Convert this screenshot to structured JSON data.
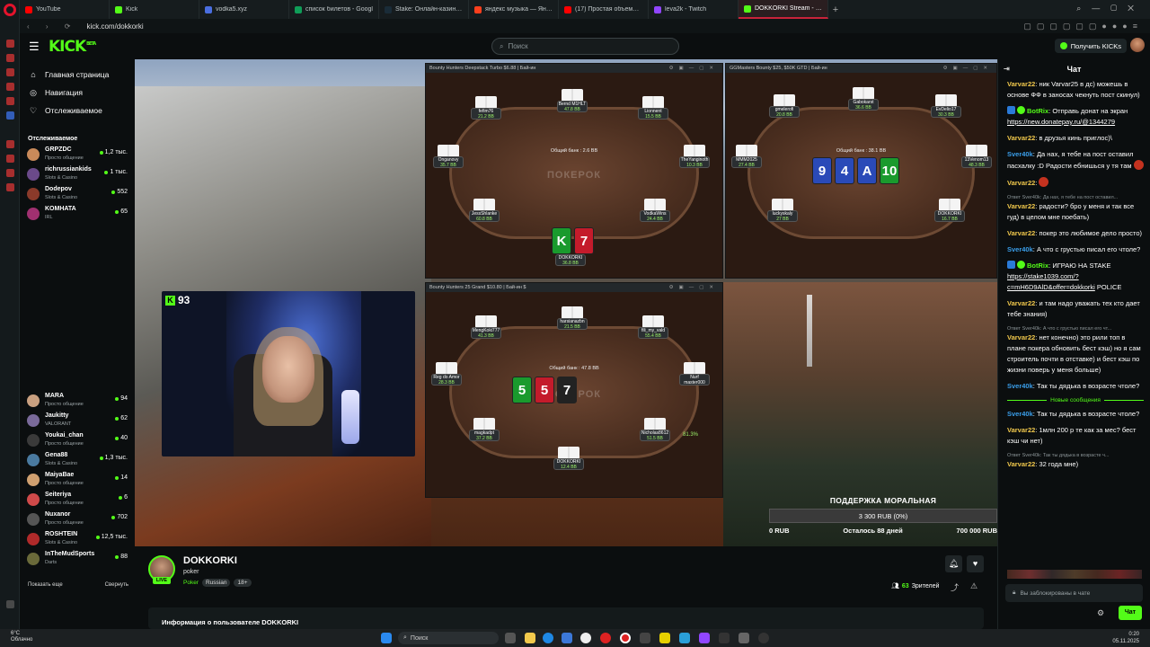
{
  "browser": {
    "tabs": [
      {
        "label": "YouTube",
        "color": "#ff0000"
      },
      {
        "label": "Kick",
        "color": "#53fc18"
      },
      {
        "label": "vodka5.xyz",
        "color": "#4a6ee0"
      },
      {
        "label": "список билетов - Googl",
        "color": "#0f9d58"
      },
      {
        "label": "Stake: Онлайн-казино и",
        "color": "#1a2c38"
      },
      {
        "label": "яндекс музыка — Яндекс",
        "color": "#fc3f1d"
      },
      {
        "label": "(17) Простая объемная",
        "color": "#ff0000"
      },
      {
        "label": "leva2k - Twitch",
        "color": "#9146ff"
      },
      {
        "label": "DOKKORKI Stream - Watc",
        "color": "#53fc18"
      }
    ],
    "url": "kick.com/dokkorki"
  },
  "header": {
    "logo": "KICK",
    "logo_beta": "BETA",
    "search_placeholder": "Поиск",
    "get_kicks": "Получить KICKs"
  },
  "sidebar": {
    "nav": [
      {
        "label": "Главная страница",
        "icon": "home-icon"
      },
      {
        "label": "Навигация",
        "icon": "compass-icon"
      },
      {
        "label": "Отслеживаемое",
        "icon": "heart-icon"
      }
    ],
    "following_title": "Отслеживаемое",
    "following": [
      {
        "name": "GRPZDC",
        "category": "Просто общение",
        "viewers": "1,2 тыс.",
        "color": "#c98a5a"
      },
      {
        "name": "richrussiankids",
        "category": "Slots & Casino",
        "viewers": "1 тыс.",
        "color": "#6b4a8a"
      },
      {
        "name": "Dodepov",
        "category": "Slots & Casino",
        "viewers": "552",
        "color": "#8a3a2a"
      },
      {
        "name": "KOMHATA",
        "category": "IRL",
        "viewers": "65",
        "color": "#a03070"
      },
      {
        "name": "MARA",
        "category": "Просто общение",
        "viewers": "94",
        "color": "#c9a080"
      },
      {
        "name": "Jaukitty",
        "category": "VALORANT",
        "viewers": "62",
        "color": "#7a6a9a"
      },
      {
        "name": "Youkai_chan",
        "category": "Просто общение",
        "viewers": "40",
        "color": "#3a3a3a"
      },
      {
        "name": "Gena88",
        "category": "Slots & Casino",
        "viewers": "1,3 тыс.",
        "color": "#4a7aa0"
      },
      {
        "name": "MaiyaBae",
        "category": "Просто общение",
        "viewers": "14",
        "color": "#d0a070"
      },
      {
        "name": "Seiteriya",
        "category": "Просто общение",
        "viewers": "6",
        "color": "#d04a4a"
      },
      {
        "name": "Nuxanor",
        "category": "Просто общение",
        "viewers": "702",
        "color": "#555555"
      },
      {
        "name": "ROSHTEIN",
        "category": "Slots & Casino",
        "viewers": "12,5 тыс.",
        "color": "#b02a2a"
      },
      {
        "name": "InTheMudSports",
        "category": "Darts",
        "viewers": "88",
        "color": "#6a6a3a"
      }
    ],
    "show_more": "Показать еще",
    "collapse": "Свернуть"
  },
  "stream": {
    "webcam_count": "93",
    "tables": [
      {
        "title": "Bounty Hunters Deepstack Turbo $6.88 | Бай-ин",
        "brand": "ПОКЕРОК",
        "pot": "Общий банк : 2.6 BB",
        "seats": [
          {
            "name": "Bernd M1HLT",
            "stack": "47.8 BB"
          },
          {
            "name": "fefim76",
            "stack": "21.2 BB"
          },
          {
            "name": "Lionnent",
            "stack": "15.5 BB"
          },
          {
            "name": "Onganovy",
            "stack": "35.7 BB"
          },
          {
            "name": "TheYanginoth",
            "stack": "10.3 BB"
          },
          {
            "name": "JessShlanke",
            "stack": "60.8 BB"
          },
          {
            "name": "VodkaWins",
            "stack": "24.4 BB"
          },
          {
            "name": "DOKKORKI",
            "stack": "36.8 BB"
          }
        ],
        "hero_cards": [
          {
            "rank": "K",
            "suit": "c-g"
          },
          {
            "rank": "7",
            "suit": "c-r"
          }
        ]
      },
      {
        "title": "GGMasters Bounty $25, $50K GTD | Бай-ин",
        "pot": "Общий банк : 38.1 BB",
        "seats": [
          {
            "name": "Gabokarst",
            "stack": "36.6 BB"
          },
          {
            "name": "gmelerofi",
            "stack": "20.8 BB"
          },
          {
            "name": "EvDelio17",
            "stack": "30.3 BB"
          },
          {
            "name": "MMM2025",
            "stack": "27.4 BB"
          },
          {
            "name": "13Venom13",
            "stack": "48.3 BB"
          },
          {
            "name": "luckyskaly",
            "stack": "27 BB"
          },
          {
            "name": "DOKKORKI",
            "stack": "16.7 BB"
          }
        ],
        "board": [
          {
            "rank": "9",
            "suit": "c-b"
          },
          {
            "rank": "4",
            "suit": "c-b"
          },
          {
            "rank": "A",
            "suit": "c-b"
          },
          {
            "rank": "10",
            "suit": "c-g"
          }
        ]
      },
      {
        "title": "Bounty Hunters 25 Grand $10.80 | Бай-ин $",
        "brand": "ПОКЕРОК",
        "pot": "Общий банк : 47.8 BB",
        "seats": [
          {
            "name": "harsianazbn",
            "stack": "21.5 BB"
          },
          {
            "name": "MengKoki777",
            "stack": "41.3 BB"
          },
          {
            "name": "fili_my_vald",
            "stack": "55.4 BB"
          },
          {
            "name": "Reg do Amor",
            "stack": "28.3 BB"
          },
          {
            "name": "Nurf master000",
            "stack": "57.3 BB"
          },
          {
            "name": "magkadpt",
            "stack": "37.2 BB"
          },
          {
            "name": "Nicholas8612",
            "stack": "51.5 BB"
          },
          {
            "name": "DOKKORKI",
            "stack": "12.4 BB"
          }
        ],
        "board": [
          {
            "rank": "5",
            "suit": "c-g"
          },
          {
            "rank": "5",
            "suit": "c-r"
          },
          {
            "rank": "7",
            "suit": "c-k"
          }
        ],
        "hero_badge": "81.3%"
      }
    ],
    "donation": {
      "title": "ПОДДЕРЖКА МОРАЛЬНАЯ",
      "progress": "3 300 RUB (0%)",
      "min": "0 RUB",
      "remaining": "Осталось 88 дней",
      "max": "700 000 RUB"
    }
  },
  "channel": {
    "name": "DOKKORKI",
    "title": "poker",
    "category": "Poker",
    "tags": [
      "Russian",
      "18+"
    ],
    "live": "LIVE",
    "viewers_count": "63",
    "viewers_label": "Зрителей",
    "about": "Информация о пользователе DOKKORKI"
  },
  "chat": {
    "title": "Чат",
    "new_messages": "Новые сообщения",
    "messages": [
      {
        "user": "Varvar22",
        "color": "#f2c94c",
        "text": "ник Varvar25 в дс) можешь в основе ФФ в заносах чекнуть пост скинул)"
      },
      {
        "user": "BotRix",
        "color": "#53fc18",
        "bot": true,
        "text": "Отправь донат на экран ",
        "link": "https://new.donatepay.ru/@1344279"
      },
      {
        "user": "Varvar22",
        "color": "#f2c94c",
        "text": "в друзья кинь приглос)\\"
      },
      {
        "user": "Sver40k",
        "color": "#3a9eea",
        "text": "Да нах, я тебе на пост оставил пасхалку :D Радости ебнишься у тя там",
        "emote": true
      },
      {
        "user": "Varvar22",
        "color": "#f2c94c",
        "text": "",
        "emote": true
      },
      {
        "user": "Varvar22",
        "color": "#f2c94c",
        "reply": "Ответ Sver40k: Да нах, я тебе на пост оставил...",
        "text": "радости? бро у меня и так все гуд) в целом мне поебать)"
      },
      {
        "user": "Varvar22",
        "color": "#f2c94c",
        "text": "покер это любимое дело просто)"
      },
      {
        "user": "Sver40k",
        "color": "#3a9eea",
        "text": "А что с грустью писал его чтоле?"
      },
      {
        "user": "BotRix",
        "color": "#53fc18",
        "bot": true,
        "text": "ИГРАЮ НА STAKE ",
        "link": "https://stake1039.com/?c=mH6D9AlD&offer=dokkorki",
        "after": " POLICE"
      },
      {
        "user": "Varvar22",
        "color": "#f2c94c",
        "text": "и там надо уважать тех кто дает тебе знания)"
      },
      {
        "user": "Varvar22",
        "color": "#f2c94c",
        "reply": "Ответ Sver40k: А что с грустью писал его чт...",
        "text": "нет конечно) это рили топ в плане покера обновить бест кэш) но я сам строитель почти в отставке) и бест кэш по жизни поверь у меня больше)"
      },
      {
        "user": "Sver40k",
        "color": "#3a9eea",
        "text": "Так ты дядька в возрасте чтоле?"
      }
    ],
    "messages_after": [
      {
        "user": "Sver40k",
        "color": "#3a9eea",
        "text": "Так ты дядька в возрасте чтоле?"
      },
      {
        "user": "Varvar22",
        "color": "#f2c94c",
        "text": "1млн 200 р те как за мес? бест кэш чи нет)"
      },
      {
        "user": "Varvar22",
        "color": "#f2c94c",
        "reply": "Ответ Sver40k: Так ты дядька в возрасте ч...",
        "text": "32 года мне)"
      }
    ],
    "input_placeholder": "Вы заблокированы в чате",
    "send": "Чат"
  },
  "taskbar": {
    "weather_temp": "6°C",
    "weather_desc": "Облачно",
    "search": "Поиск",
    "time": "0:20",
    "date": "05.11.2025"
  }
}
